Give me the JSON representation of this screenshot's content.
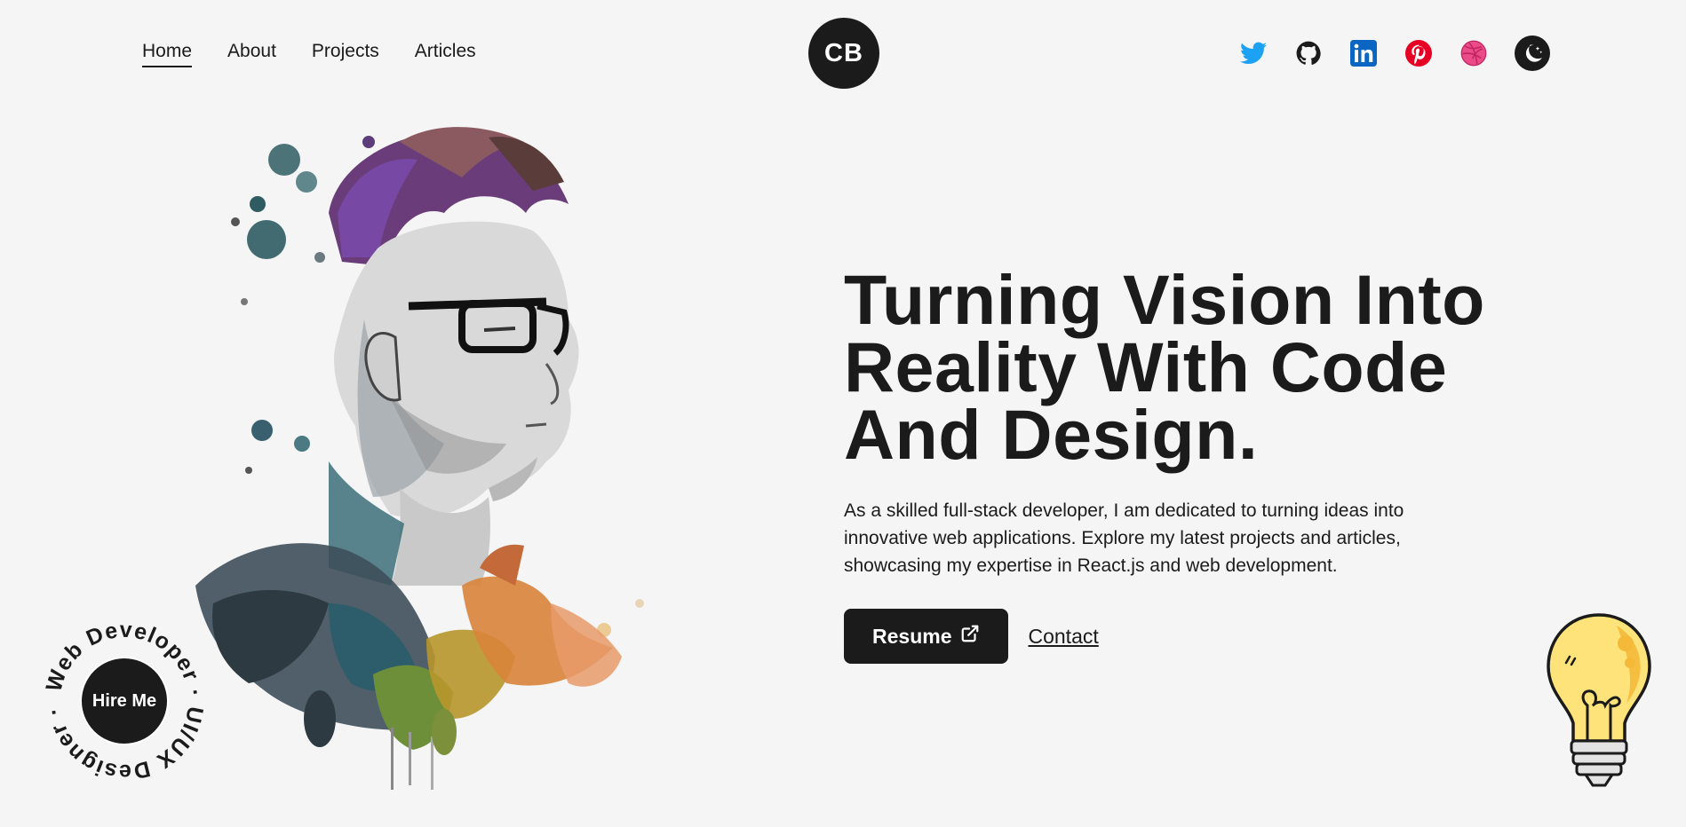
{
  "nav": {
    "links": [
      {
        "label": "Home",
        "active": true
      },
      {
        "label": "About",
        "active": false
      },
      {
        "label": "Projects",
        "active": false
      },
      {
        "label": "Articles",
        "active": false
      }
    ],
    "logo": "CB",
    "socials": [
      "twitter-icon",
      "github-icon",
      "linkedin-icon",
      "pinterest-icon",
      "dribbble-icon"
    ],
    "theme_toggle": "moon-icon"
  },
  "hero": {
    "headline_lines": [
      "Turning Vision Into",
      "Reality With Code",
      "And Design."
    ],
    "lead": "As a skilled full-stack developer, I am dedicated to turning ideas into innovative web applications. Explore my latest projects and articles, showcasing my expertise in React.js and web development.",
    "resume_label": "Resume",
    "contact_label": "Contact"
  },
  "hire": {
    "label": "Hire Me",
    "ring_text": "Web Developer · UI/UX Designer · "
  },
  "colors": {
    "background": "#f5f5f5",
    "dark": "#1b1b1b",
    "twitter": "#1da1f2",
    "linkedin": "#0a66c2",
    "pinterest": "#e60023",
    "dribbble": "#ea4c89"
  }
}
